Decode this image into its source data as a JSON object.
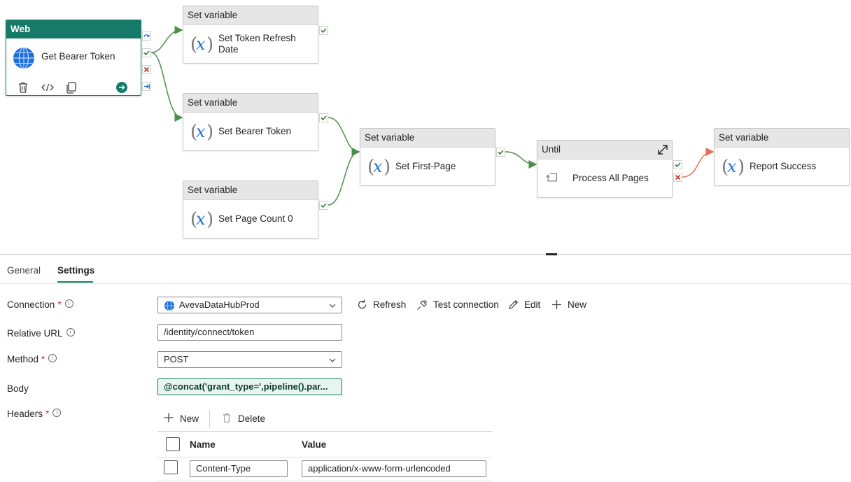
{
  "canvas": {
    "nodes": {
      "web": {
        "type": "Web",
        "title": "Get Bearer Token"
      },
      "set_refresh": {
        "type": "Set variable",
        "title_line1": "Set Token Refresh",
        "title_line2": "Date"
      },
      "set_bearer": {
        "type": "Set variable",
        "title": "Set Bearer Token"
      },
      "set_page_count": {
        "type": "Set variable",
        "title": "Set Page Count 0"
      },
      "set_first_page": {
        "type": "Set variable",
        "title": "Set First-Page"
      },
      "until": {
        "type": "Until",
        "title": "Process All Pages"
      },
      "report": {
        "type": "Set variable",
        "title": "Report Success"
      }
    },
    "colors": {
      "success": "#2e7d32",
      "failure": "#c0392b",
      "web_header": "#167a68",
      "edge_success": "#4a8f4a",
      "edge_failure": "#e0735a"
    }
  },
  "tabs": {
    "general": "General",
    "settings": "Settings"
  },
  "settings": {
    "connection": {
      "label": "Connection",
      "value": "AvevaDataHubProd"
    },
    "actions": {
      "refresh": "Refresh",
      "test": "Test connection",
      "edit": "Edit",
      "new": "New"
    },
    "relative_url": {
      "label": "Relative URL",
      "value": "/identity/connect/token"
    },
    "method": {
      "label": "Method",
      "value": "POST"
    },
    "body": {
      "label": "Body",
      "value": "@concat('grant_type=',pipeline().par..."
    },
    "headers": {
      "label": "Headers",
      "new": "New",
      "delete": "Delete",
      "col_name": "Name",
      "col_value": "Value",
      "rows": [
        {
          "name": "Content-Type",
          "value": "application/x-www-form-urlencoded"
        }
      ]
    },
    "required_mark": "*",
    "info_mark": "i"
  }
}
